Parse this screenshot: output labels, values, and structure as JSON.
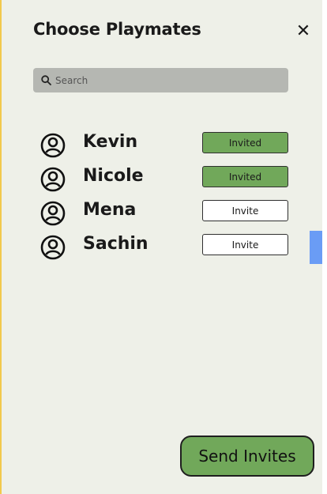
{
  "header": {
    "title": "Choose Playmates",
    "close_glyph": "✕"
  },
  "search": {
    "placeholder": "Search",
    "icon": "search-icon"
  },
  "playmates": [
    {
      "name": "Kevin",
      "button_label": "Invited",
      "status": "invited"
    },
    {
      "name": "Nicole",
      "button_label": "Invited",
      "status": "invited"
    },
    {
      "name": "Mena",
      "button_label": "Invite",
      "status": "not-invited"
    },
    {
      "name": "Sachin",
      "button_label": "Invite",
      "status": "not-invited"
    }
  ],
  "footer": {
    "send_label": "Send Invites"
  },
  "colors": {
    "background": "#eef0e8",
    "invited_green": "#71a85a",
    "search_bar": "#b5b7b2",
    "accent_blue": "#6a9cf5",
    "frame_yellow": "#f2c94c"
  }
}
